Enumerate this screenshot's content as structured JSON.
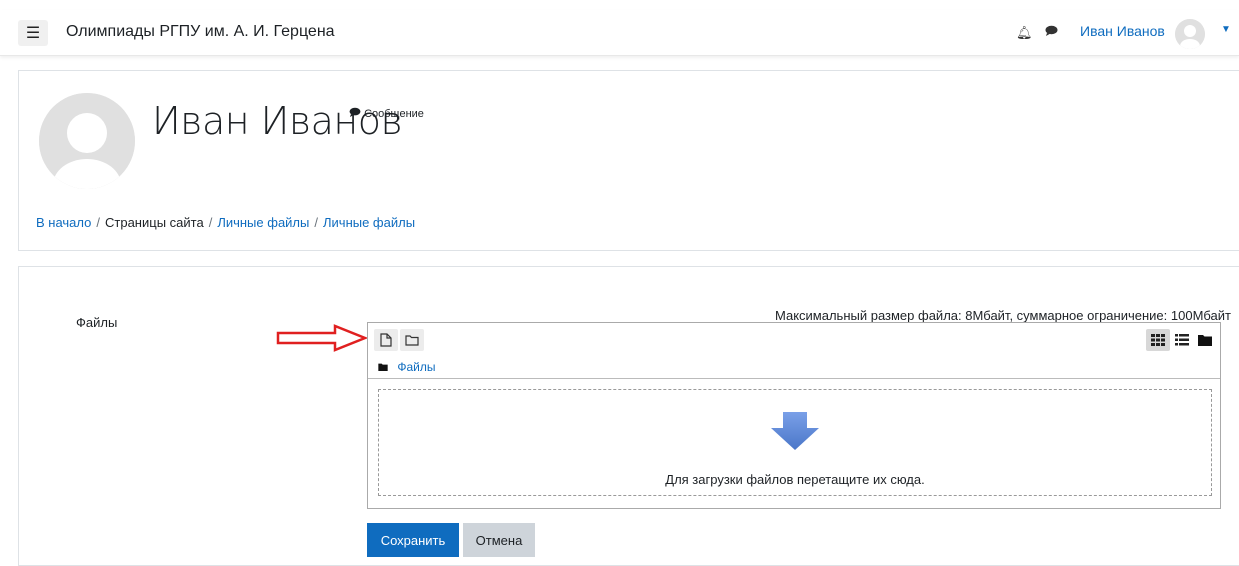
{
  "topbar": {
    "menu_icon": "hamburger-icon",
    "site_name": "Олимпиады РГПУ им. А. И. Герцена",
    "user_name": "Иван Иванов"
  },
  "profile": {
    "name": "Иван Иванов",
    "message_label": "Сообщение"
  },
  "breadcrumb": [
    "В начало",
    "Страницы сайта",
    "Личные файлы",
    "Личные файлы"
  ],
  "filemanager": {
    "field_label": "Файлы",
    "limits_text": "Максимальный размер файла: 8Мбайт, суммарное ограничение: 100Мбайт",
    "path_label": "Файлы",
    "drop_text": "Для загрузки файлов перетащите их сюда."
  },
  "buttons": {
    "save": "Сохранить",
    "cancel": "Отмена"
  },
  "colors": {
    "link": "#0f6cbf",
    "primary": "#0f6cbf",
    "annotation_arrow": "#e02020",
    "drop_arrow": "#5b86d6"
  }
}
